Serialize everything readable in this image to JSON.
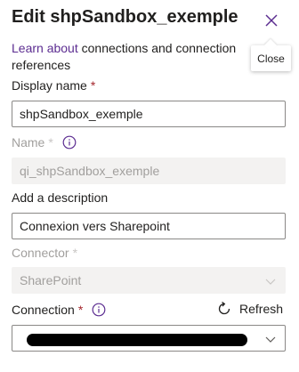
{
  "dialog": {
    "title": "Edit shpSandbox_exemple",
    "close_tooltip": "Close"
  },
  "intro": {
    "link_text": "Learn about",
    "text": " connections and connection references"
  },
  "display_name": {
    "label": "Display name",
    "required_mark": "*",
    "value": "shpSandbox_exemple"
  },
  "name": {
    "label": "Name",
    "required_mark": "*",
    "value": "qi_shpSandbox_exemple"
  },
  "description": {
    "label": "Add a description",
    "value": "Connexion vers Sharepoint"
  },
  "connector": {
    "label": "Connector",
    "required_mark": "*",
    "value": "SharePoint"
  },
  "connection": {
    "label": "Connection",
    "required_mark": "*",
    "refresh_label": "Refresh"
  },
  "colors": {
    "link": "#5c2d91",
    "required": "#a4262c",
    "disabled_text": "#a19f9d",
    "disabled_bg": "#f3f2f1",
    "border": "#8a8886"
  },
  "icons": {
    "close": "close-icon",
    "info": "info-icon",
    "chevron": "chevron-down-icon",
    "refresh": "refresh-icon"
  }
}
